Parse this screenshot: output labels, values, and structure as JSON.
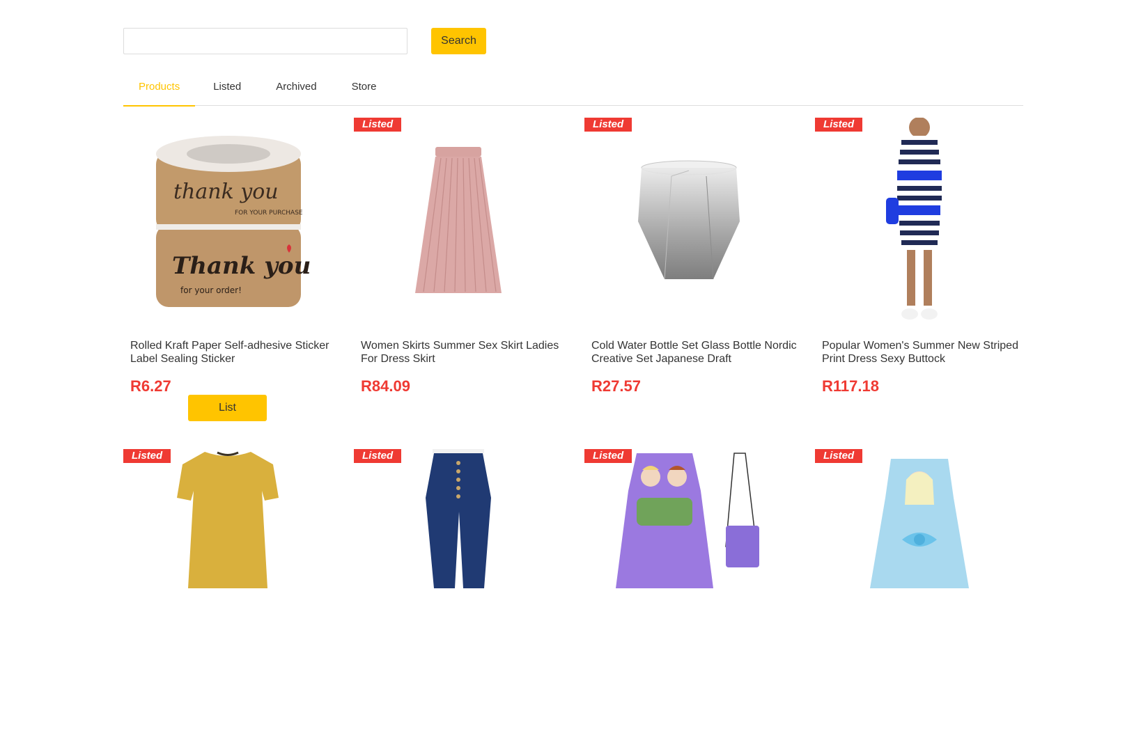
{
  "search": {
    "placeholder": "",
    "value": "",
    "button_label": "Search"
  },
  "tabs": [
    {
      "label": "Products",
      "active": true
    },
    {
      "label": "Listed",
      "active": false
    },
    {
      "label": "Archived",
      "active": false
    },
    {
      "label": "Store",
      "active": false
    }
  ],
  "colors": {
    "accent": "#ffc400",
    "badge": "#ef3a33",
    "price": "#ef3a33"
  },
  "products": [
    {
      "title": "Rolled Kraft Paper Self-adhesive Sticker Label Sealing Sticker",
      "price": "R6.27",
      "badge": "",
      "action_label": "List",
      "image_icon": "kraft-sticker-roll-image",
      "sticker_text": {
        "top": "thank you",
        "top_sub": "FOR YOUR PURCHASE",
        "bottom": "Thank you",
        "bottom_sub": "for your order!"
      }
    },
    {
      "title": "Women Skirts Summer Sex Skirt Ladies For Dress Skirt",
      "price": "R84.09",
      "badge": "Listed",
      "image_icon": "pleated-skirt-image"
    },
    {
      "title": "Cold Water Bottle Set Glass Bottle Nordic Creative Set Japanese Draft",
      "price": "R27.57",
      "badge": "Listed",
      "image_icon": "glass-cup-image"
    },
    {
      "title": "Popular Women's Summer New Striped Print Dress Sexy Buttock",
      "price": "R117.18",
      "badge": "Listed",
      "image_icon": "striped-dress-image"
    },
    {
      "title": "",
      "price": "",
      "badge": "Listed",
      "image_icon": "yellow-dress-image"
    },
    {
      "title": "",
      "price": "",
      "badge": "Listed",
      "image_icon": "jeans-image"
    },
    {
      "title": "",
      "price": "",
      "badge": "Listed",
      "image_icon": "frozen-dress-bag-image"
    },
    {
      "title": "",
      "price": "",
      "badge": "Listed",
      "image_icon": "elsa-dress-image"
    }
  ]
}
